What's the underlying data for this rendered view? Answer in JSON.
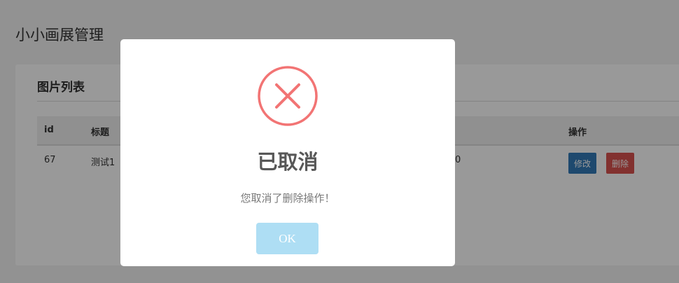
{
  "page": {
    "title": "小小画展管理"
  },
  "panel": {
    "heading": "图片列表",
    "columns": {
      "id": "id",
      "title": "标题",
      "actions": "操作"
    },
    "rows": [
      {
        "id": "67",
        "title": "测试1",
        "partial": "0",
        "edit_label": "修改",
        "delete_label": "删除"
      }
    ]
  },
  "dialog": {
    "title": "已取消",
    "message": "您取消了删除操作！",
    "ok_label": "OK",
    "icon": "error-x-icon",
    "icon_color": "#f27474",
    "button_color": "#aedef4"
  },
  "colors": {
    "edit_button": "#337ab7",
    "delete_button": "#d9534f"
  }
}
